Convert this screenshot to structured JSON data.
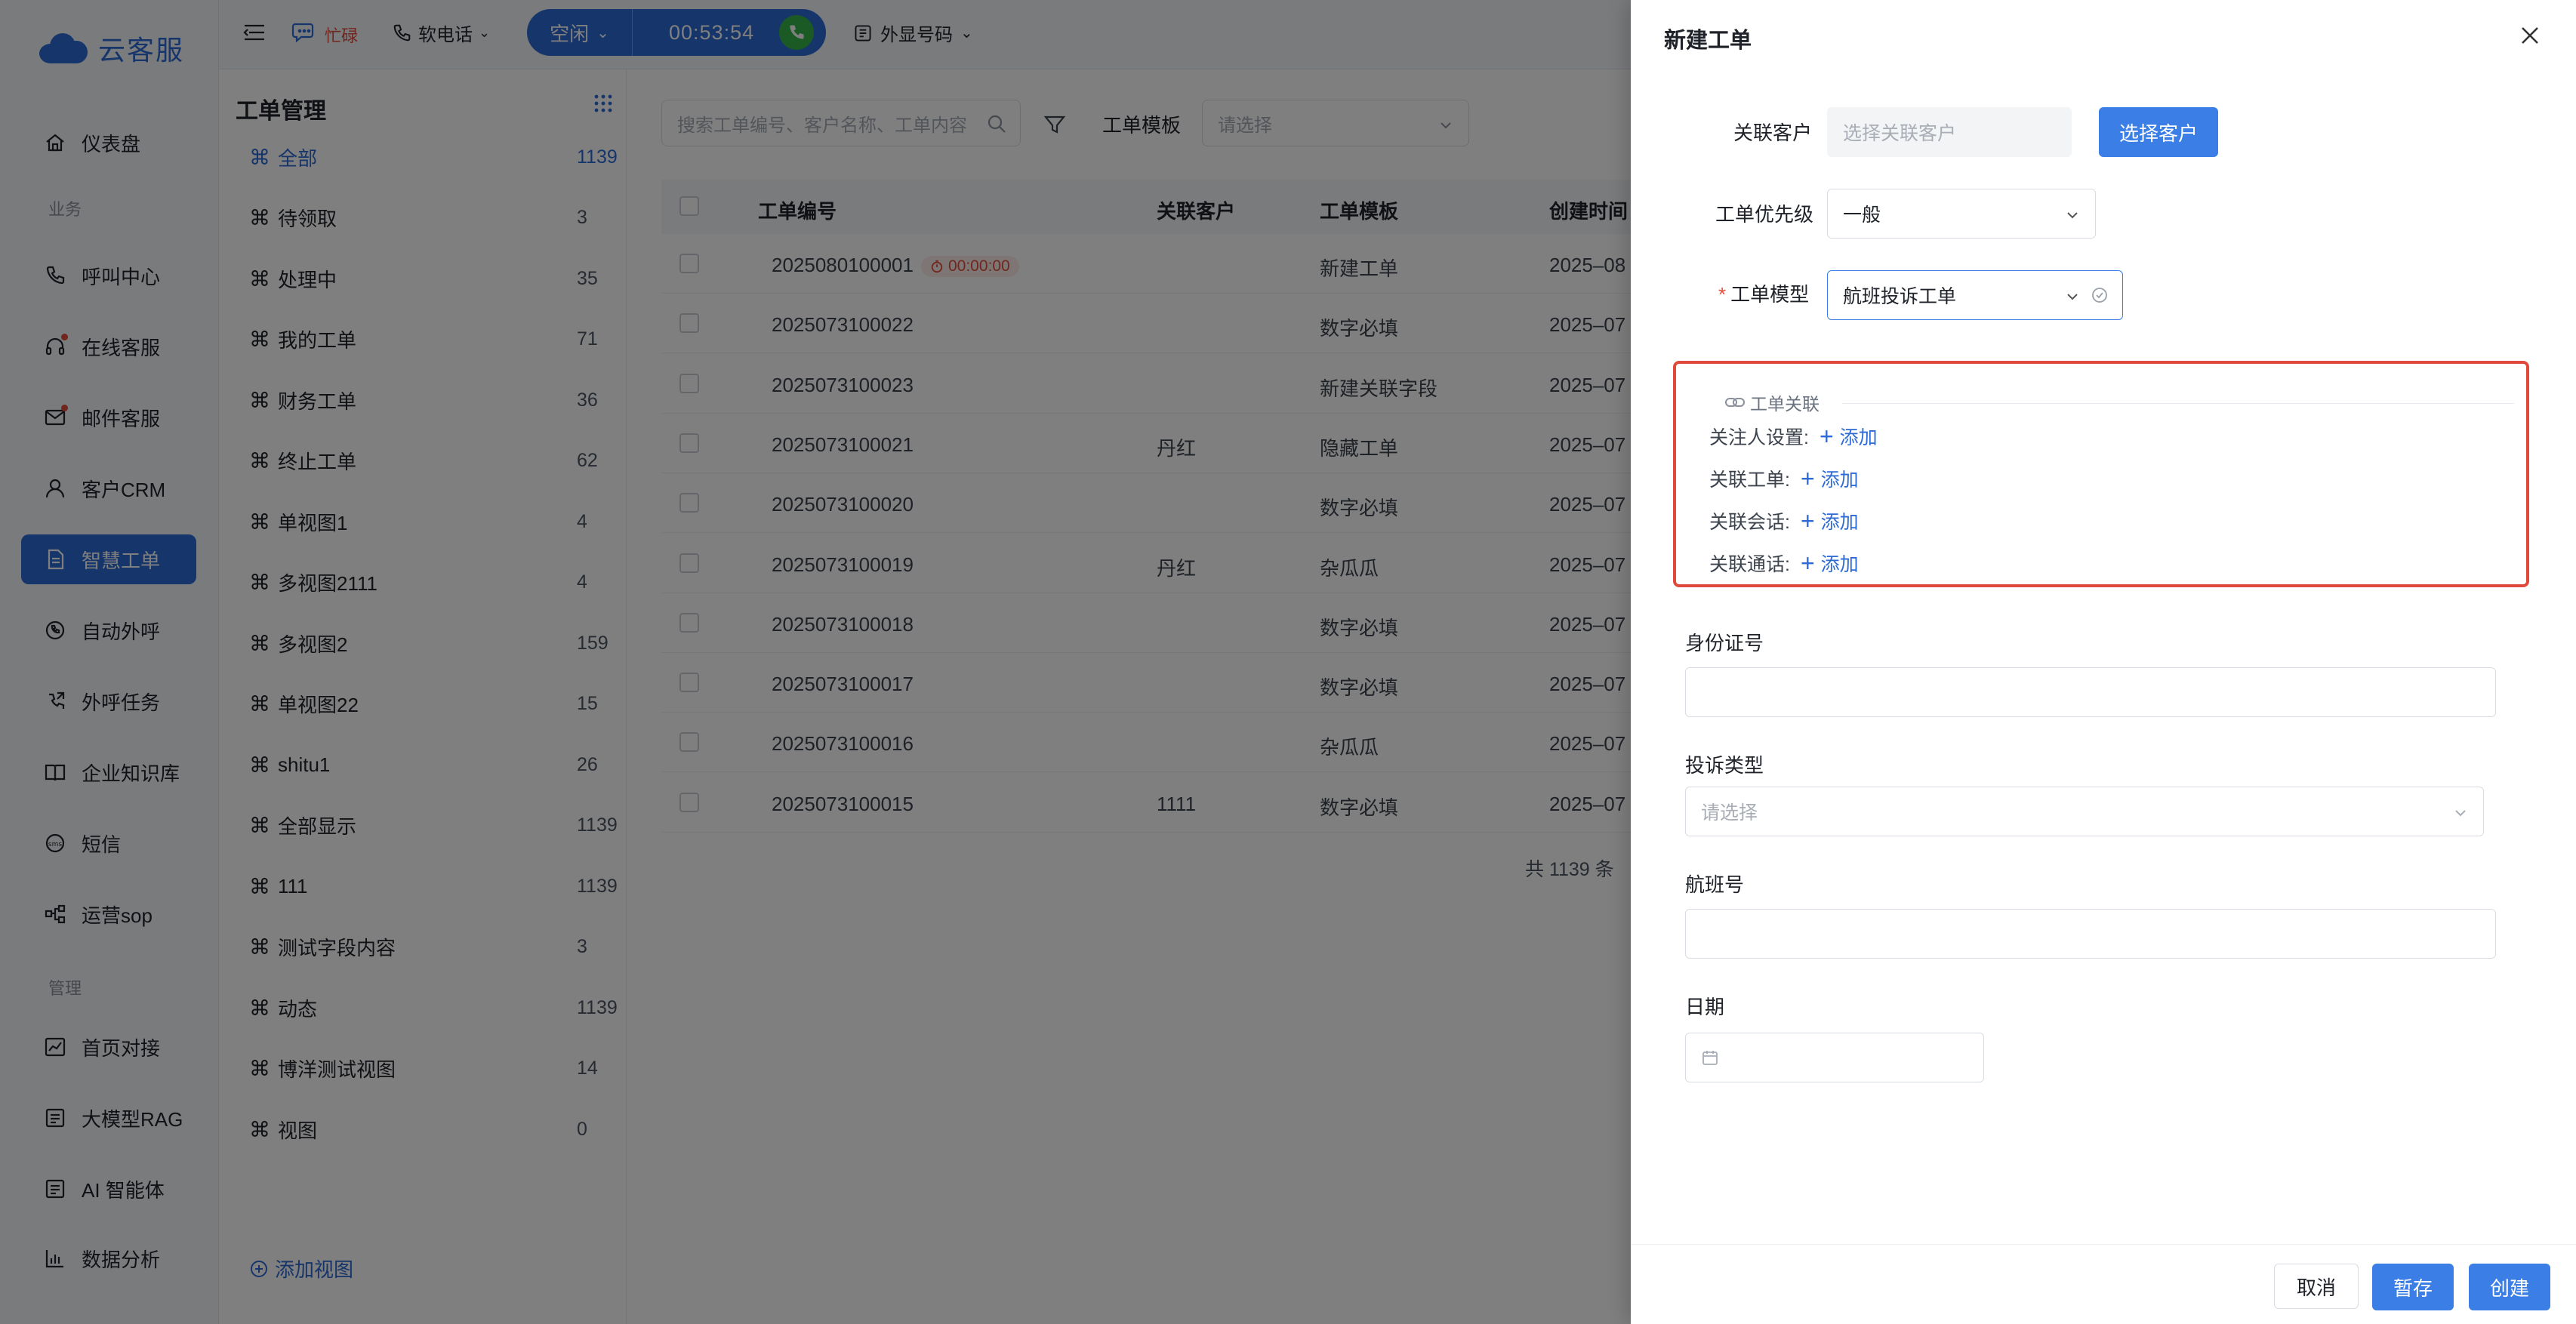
{
  "brand": {
    "name": "云客服",
    "color": "#2c6ad6"
  },
  "sidebar": {
    "items": [
      {
        "label": "仪表盘",
        "icon": "home-icon"
      },
      {
        "section": "业务"
      },
      {
        "label": "呼叫中心",
        "icon": "phone-icon"
      },
      {
        "label": "在线客服",
        "icon": "headset-icon",
        "dot": true
      },
      {
        "label": "邮件客服",
        "icon": "mail-icon",
        "dot": true
      },
      {
        "label": "客户CRM",
        "icon": "user-icon"
      },
      {
        "label": "智慧工单",
        "icon": "ticket-icon",
        "active": true
      },
      {
        "label": "自动外呼",
        "icon": "auto-call-icon"
      },
      {
        "label": "外呼任务",
        "icon": "outbound-task-icon"
      },
      {
        "label": "企业知识库",
        "icon": "book-icon"
      },
      {
        "label": "短信",
        "icon": "sms-icon"
      },
      {
        "label": "运营sop",
        "icon": "flow-icon"
      },
      {
        "section": "管理"
      },
      {
        "label": "首页对接",
        "icon": "chart-icon"
      },
      {
        "label": "大模型RAG",
        "icon": "model-icon"
      },
      {
        "label": "AI 智能体",
        "icon": "agent-icon"
      },
      {
        "label": "数据分析",
        "icon": "bar-chart-icon"
      }
    ]
  },
  "topbar": {
    "busy": "忙碌",
    "softphone": "软电话",
    "status": "空闲",
    "timer": "00:53:54",
    "out_number": "外显号码"
  },
  "views": {
    "title": "工单管理",
    "items": [
      {
        "label": "全部",
        "count": "1139",
        "active": true
      },
      {
        "label": "待领取",
        "count": "3"
      },
      {
        "label": "处理中",
        "count": "35"
      },
      {
        "label": "我的工单",
        "count": "71"
      },
      {
        "label": "财务工单",
        "count": "36"
      },
      {
        "label": "终止工单",
        "count": "62"
      },
      {
        "label": "单视图1",
        "count": "4"
      },
      {
        "label": "多视图2111",
        "count": "4"
      },
      {
        "label": "多视图2",
        "count": "159"
      },
      {
        "label": "单视图22",
        "count": "15"
      },
      {
        "label": "shitu1",
        "count": "26"
      },
      {
        "label": "全部显示",
        "count": "1139"
      },
      {
        "label": "111",
        "count": "1139"
      },
      {
        "label": "测试字段内容",
        "count": "3"
      },
      {
        "label": "动态",
        "count": "1139"
      },
      {
        "label": "博洋测试视图",
        "count": "14"
      },
      {
        "label": "视图",
        "count": "0"
      }
    ],
    "add_label": "添加视图"
  },
  "list": {
    "search_placeholder": "搜索工单编号、客户名称、工单内容",
    "template_label": "工单模板",
    "template_placeholder": "请选择",
    "columns": [
      "工单编号",
      "关联客户",
      "工单模板",
      "创建时间"
    ],
    "rows": [
      {
        "id": "2025080100001",
        "customer": "",
        "template": "新建工单",
        "created": "2025–08",
        "timer": "00:00:00"
      },
      {
        "id": "2025073100022",
        "customer": "",
        "template": "数字必填",
        "created": "2025–07"
      },
      {
        "id": "2025073100023",
        "customer": "",
        "template": "新建关联字段",
        "created": "2025–07"
      },
      {
        "id": "2025073100021",
        "customer": "丹红",
        "template": "隐藏工单",
        "created": "2025–07"
      },
      {
        "id": "2025073100020",
        "customer": "",
        "template": "数字必填",
        "created": "2025–07"
      },
      {
        "id": "2025073100019",
        "customer": "丹红",
        "template": "杂瓜瓜",
        "created": "2025–07"
      },
      {
        "id": "2025073100018",
        "customer": "",
        "template": "数字必填",
        "created": "2025–07"
      },
      {
        "id": "2025073100017",
        "customer": "",
        "template": "数字必填",
        "created": "2025–07"
      },
      {
        "id": "2025073100016",
        "customer": "",
        "template": "杂瓜瓜",
        "created": "2025–07"
      },
      {
        "id": "2025073100015",
        "customer": "1111",
        "template": "数字必填",
        "created": "2025–07"
      }
    ],
    "total": "共 1139 条"
  },
  "drawer": {
    "title": "新建工单",
    "customer_label": "关联客户",
    "customer_placeholder": "选择关联客户",
    "select_customer_btn": "选择客户",
    "priority_label": "工单优先级",
    "priority_value": "一般",
    "model_label": "工单模型",
    "model_value": "航班投诉工单",
    "assoc": {
      "title": "工单关联",
      "rows": [
        {
          "label": "关注人设置:",
          "add": "添加"
        },
        {
          "label": "关联工单:",
          "add": "添加"
        },
        {
          "label": "关联会话:",
          "add": "添加"
        },
        {
          "label": "关联通话:",
          "add": "添加"
        }
      ]
    },
    "id_label": "身份证号",
    "complaint_label": "投诉类型",
    "complaint_placeholder": "请选择",
    "flight_label": "航班号",
    "date_label": "日期",
    "cancel": "取消",
    "save": "暂存",
    "create": "创建"
  }
}
